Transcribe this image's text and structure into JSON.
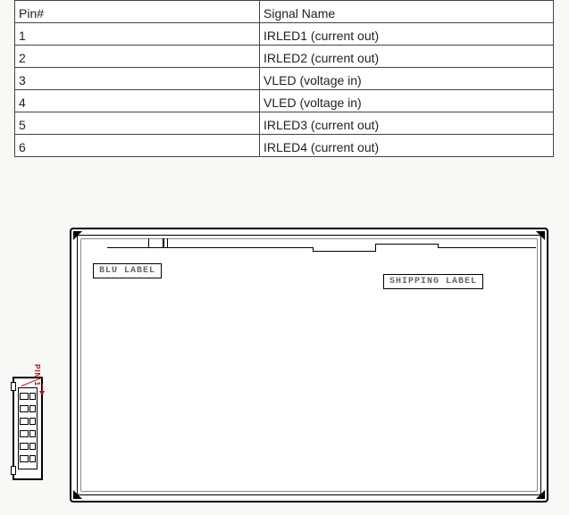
{
  "table": {
    "headers": {
      "pin": "Pin#",
      "signal": "Signal Name"
    },
    "rows": [
      {
        "pin": "1",
        "signal": "IRLED1 (current out)"
      },
      {
        "pin": "2",
        "signal": "IRLED2 (current out)"
      },
      {
        "pin": "3",
        "signal": "VLED (voltage in)"
      },
      {
        "pin": "4",
        "signal": "VLED (voltage in)"
      },
      {
        "pin": "5",
        "signal": "IRLED3 (current out)"
      },
      {
        "pin": "6",
        "signal": "IRLED4 (current out)"
      }
    ]
  },
  "drawing": {
    "blu_label": "BLU LABEL",
    "shipping_label": "SHIPPING LABEL",
    "pin1_mark": "PIN 1",
    "connector_pin_count": 6
  }
}
